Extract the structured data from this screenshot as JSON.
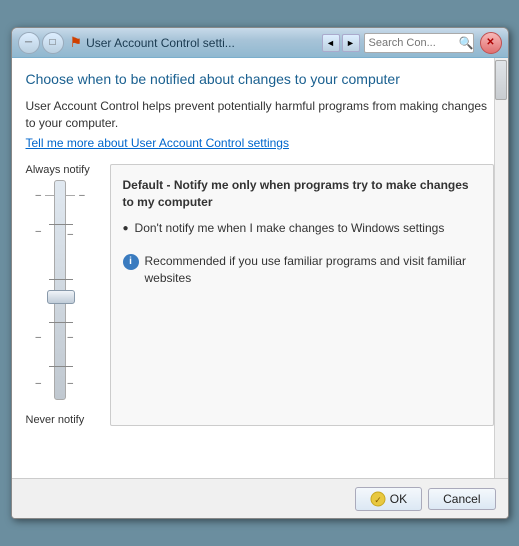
{
  "window": {
    "title": "User Account Control setti...",
    "search_placeholder": "Search Con..."
  },
  "toolbar": {
    "breadcrumb": "« User Account Control setti...",
    "back_label": "‹",
    "forward_label": "›",
    "refresh_label": "⟳"
  },
  "content": {
    "heading": "Choose when to be notified about changes to your computer",
    "description": "User Account Control helps prevent potentially harmful programs from making changes to your computer.",
    "learn_more": "Tell me more about User Account Control settings",
    "slider": {
      "top_label": "Always notify",
      "bottom_label": "Never notify"
    },
    "desc_box": {
      "title": "Default - Notify me only when programs try to make changes to my computer",
      "bullet": "Don't notify me when I make changes to Windows settings",
      "info": "Recommended if you use familiar programs and visit familiar websites"
    }
  },
  "footer": {
    "ok_label": "OK",
    "cancel_label": "Cancel"
  },
  "icons": {
    "minimize": "─",
    "maximize": "□",
    "close": "✕",
    "info": "i"
  }
}
